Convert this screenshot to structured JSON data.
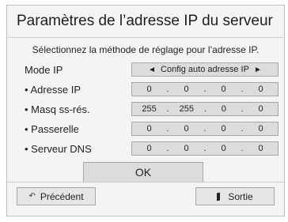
{
  "dialog": {
    "title": "Paramètres de l’adresse IP du serveur",
    "instruction": "Sélectionnez la méthode de réglage pour l’adresse IP."
  },
  "mode": {
    "label": "Mode IP",
    "left_arrow": "◄",
    "value": "Config auto adresse IP",
    "right_arrow": "►"
  },
  "rows": [
    {
      "label": "• Adresse IP",
      "octets": [
        "0",
        "0",
        "0",
        "0"
      ]
    },
    {
      "label": "• Masq ss-rés.",
      "octets": [
        "255",
        "255",
        "0",
        "0"
      ]
    },
    {
      "label": "• Passerelle",
      "octets": [
        "0",
        "0",
        "0",
        "0"
      ]
    },
    {
      "label": "• Serveur DNS",
      "octets": [
        "0",
        "0",
        "0",
        "0"
      ]
    }
  ],
  "separator": ".",
  "buttons": {
    "ok": "OK",
    "back": "Précédent",
    "exit": "Sortie"
  },
  "icons": {
    "back": "return-arrow-icon",
    "exit": "exit-icon"
  }
}
